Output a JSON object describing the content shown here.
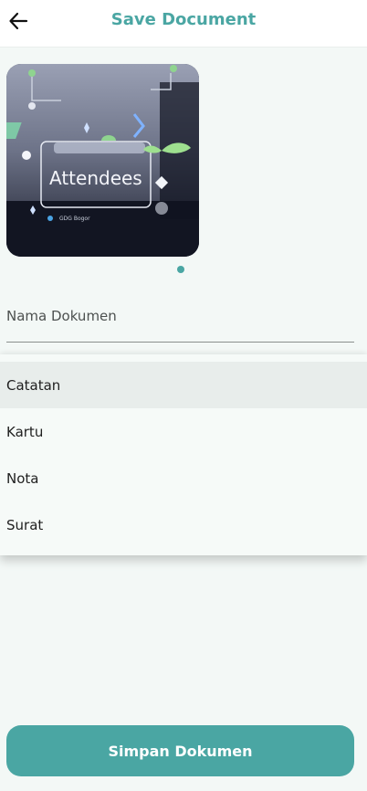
{
  "header": {
    "title": "Save Document",
    "back_icon": "arrow-left-icon"
  },
  "preview": {
    "image_text": "Attendees",
    "image_caption": "GDG Bogor",
    "page_count": 1,
    "current_page": 1
  },
  "form": {
    "name_placeholder": "Nama Dokumen",
    "name_value": ""
  },
  "dropdown": {
    "options": [
      "Catatan",
      "Kartu",
      "Nota",
      "Surat"
    ],
    "highlighted": "Catatan"
  },
  "actions": {
    "save_label": "Simpan Dokumen"
  },
  "colors": {
    "accent": "#4aa6a3",
    "background": "#f3f8f6"
  }
}
